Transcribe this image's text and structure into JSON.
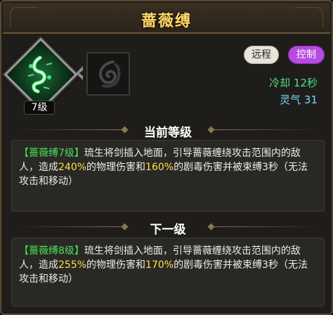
{
  "title": "蔷薇缚",
  "skill": {
    "level_badge": "7级",
    "glyph_icon": "thorn-vine-icon",
    "locked_icon": "fire-swirl-icon"
  },
  "tags": {
    "range": "远程",
    "control": "控制"
  },
  "stats": {
    "cooldown": "冷却 12秒",
    "qi": "灵气 31"
  },
  "current": {
    "header": "当前等级",
    "name_tag": "【蔷薇缚7级】",
    "text_a": "琉生将剑插入地面，引导蔷薇缠绕攻击范围内的敌人，造成",
    "pct1": "240%",
    "text_b": "的物理伤害和",
    "pct2": "160%",
    "text_c": "的剧毒伤害并被束缚3秒（无法攻击和移动）"
  },
  "next": {
    "header": "下一级",
    "name_tag": "【蔷薇缚8级】",
    "text_a": "琉生将剑插入地面，引导蔷薇缠绕攻击范围内的敌人，造成",
    "pct1": "255%",
    "text_b": "的物理伤害和",
    "pct2": "170%",
    "text_c": "的剧毒伤害并被束缚3秒（无法攻击和移动）"
  },
  "colors": {
    "title": "#ffd96a",
    "highlight_green": "#48e05a",
    "highlight_yellow": "#ffe04a",
    "cooldown": "#4be080",
    "qi": "#7ad8ff",
    "tag_control": "#b64be0"
  }
}
